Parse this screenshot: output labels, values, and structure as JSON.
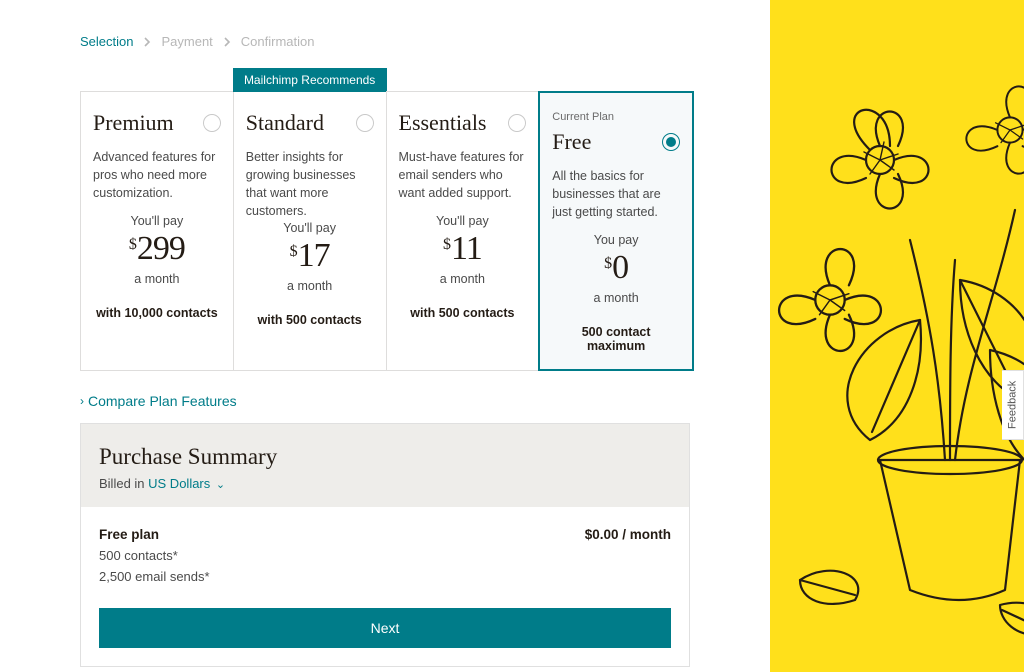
{
  "breadcrumbs": {
    "step1": "Selection",
    "step2": "Payment",
    "step3": "Confirmation"
  },
  "recommend_label": "Mailchimp Recommends",
  "current_plan_label": "Current Plan",
  "plans": [
    {
      "name": "Premium",
      "desc": "Advanced features for pros who need more customization.",
      "pay_label": "You'll pay",
      "currency": "$",
      "price": "299",
      "period": "a month",
      "contacts": "with 10,000 contacts"
    },
    {
      "name": "Standard",
      "desc": "Better insights for growing businesses that want more customers.",
      "pay_label": "You'll pay",
      "currency": "$",
      "price": "17",
      "period": "a month",
      "contacts": "with 500 contacts"
    },
    {
      "name": "Essentials",
      "desc": "Must-have features for email senders who want added support.",
      "pay_label": "You'll pay",
      "currency": "$",
      "price": "11",
      "period": "a month",
      "contacts": "with 500 contacts"
    },
    {
      "name": "Free",
      "desc": "All the basics for businesses that are just getting started.",
      "pay_label": "You pay",
      "currency": "$",
      "price": "0",
      "period": "a month",
      "contacts": "500 contact maximum"
    }
  ],
  "compare_label": "Compare Plan Features",
  "summary": {
    "title": "Purchase Summary",
    "billed_prefix": "Billed in ",
    "currency_name": "US Dollars",
    "plan_name": "Free plan",
    "plan_price": "$0.00 / month",
    "line1": "500 contacts*",
    "line2": "2,500 email sends*",
    "next": "Next"
  },
  "feedback_label": "Feedback"
}
